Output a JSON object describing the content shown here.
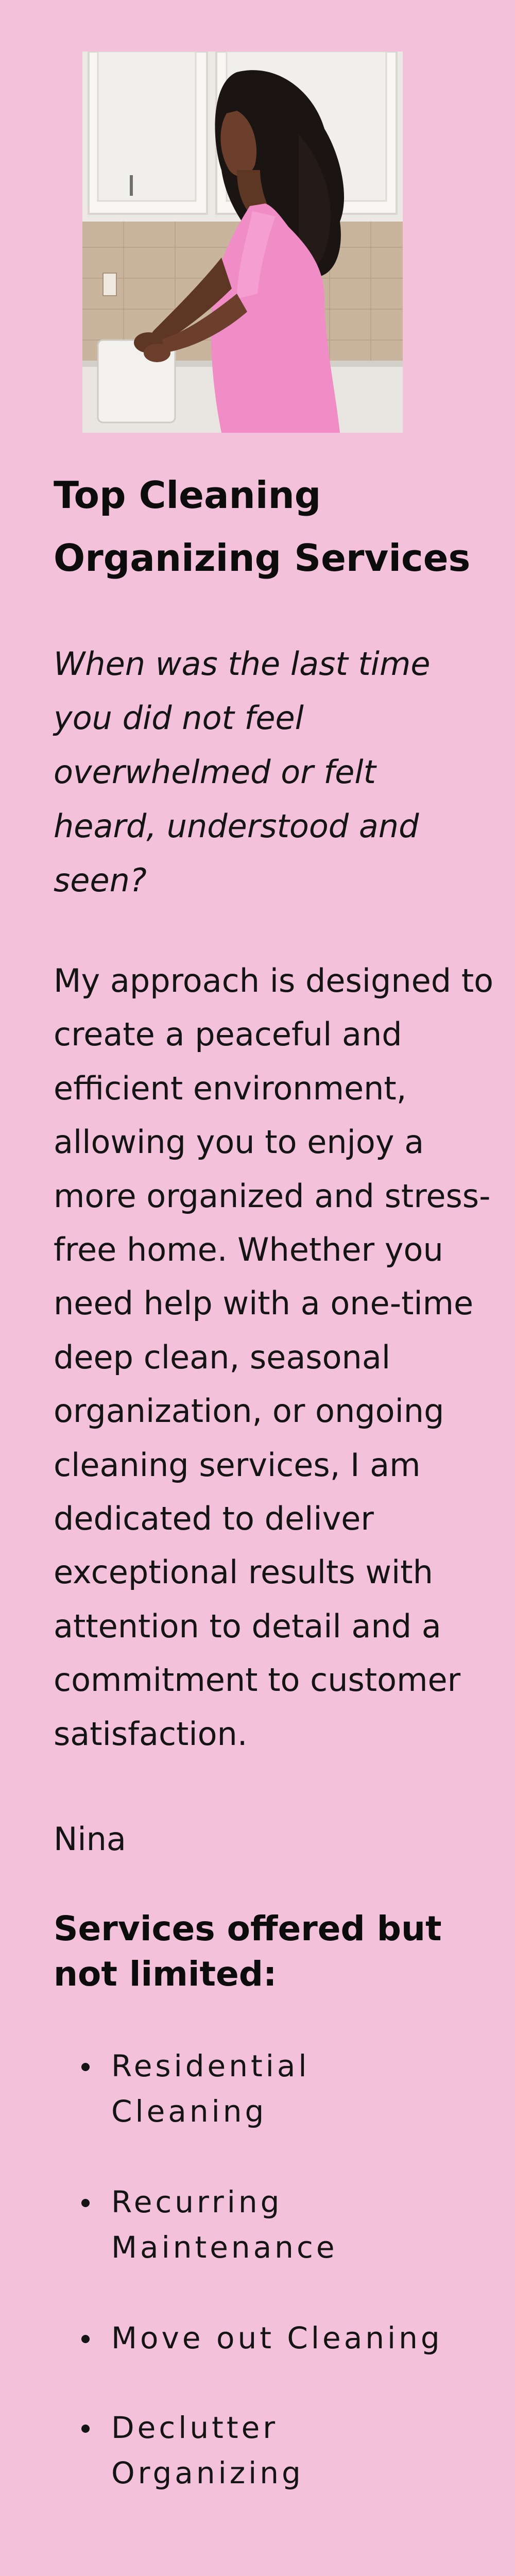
{
  "hero_image": {
    "icon": "woman-cleaning-kitchen-photo"
  },
  "title": {
    "line1": "Top Cleaning",
    "line2": "Organizing Services"
  },
  "quote": "When was the last time you did not feel overwhelmed or felt heard, understood and seen?",
  "body": "My approach is designed to create a peaceful and efficient environment, allowing you to enjoy a more organized and stress-free home. Whether you need help with a one-time deep clean, seasonal organization, or ongoing cleaning services, I am dedicated to deliver exceptional results with attention to detail and a commitment to customer satisfaction.",
  "signature": "Nina",
  "services": {
    "heading": "Services offered but not limited:",
    "items": [
      {
        "label": "Residential Cleaning"
      },
      {
        "label": "Recurring Maintenance"
      },
      {
        "label": "Move out Cleaning"
      },
      {
        "label": "Declutter Organizing"
      }
    ]
  },
  "colors": {
    "background": "#f3c1d9",
    "text": "#141414",
    "dress": "#f08cc6"
  }
}
